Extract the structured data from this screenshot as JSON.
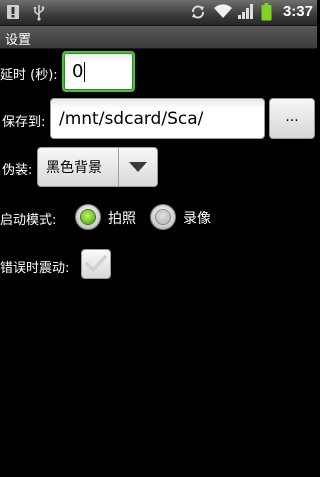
{
  "statusbar": {
    "left_icons": [
      "notification-icon",
      "usb-icon"
    ],
    "right_icons": [
      "sync-icon",
      "wifi-icon",
      "signal-icon",
      "battery-icon"
    ],
    "time": "3:37"
  },
  "title": "设置",
  "delay": {
    "label": "延时 (秒):",
    "value": "0"
  },
  "save_to": {
    "label": "保存到:",
    "value": "/mnt/sdcard/Sca/",
    "browse_label": "..."
  },
  "disguise": {
    "label": "伪装:",
    "selected": "黑色背景",
    "arrow_icon": "dropdown-arrow-icon"
  },
  "start_mode": {
    "label": "启动模式:",
    "options": [
      {
        "label": "拍照",
        "selected": true
      },
      {
        "label": "录像",
        "selected": false
      }
    ]
  },
  "vibrate_on_error": {
    "label": "错误时震动:",
    "checked": false
  },
  "colors": {
    "background": "#000000",
    "focus_border": "#48c23c",
    "radio_selected": "#6fc21f"
  }
}
